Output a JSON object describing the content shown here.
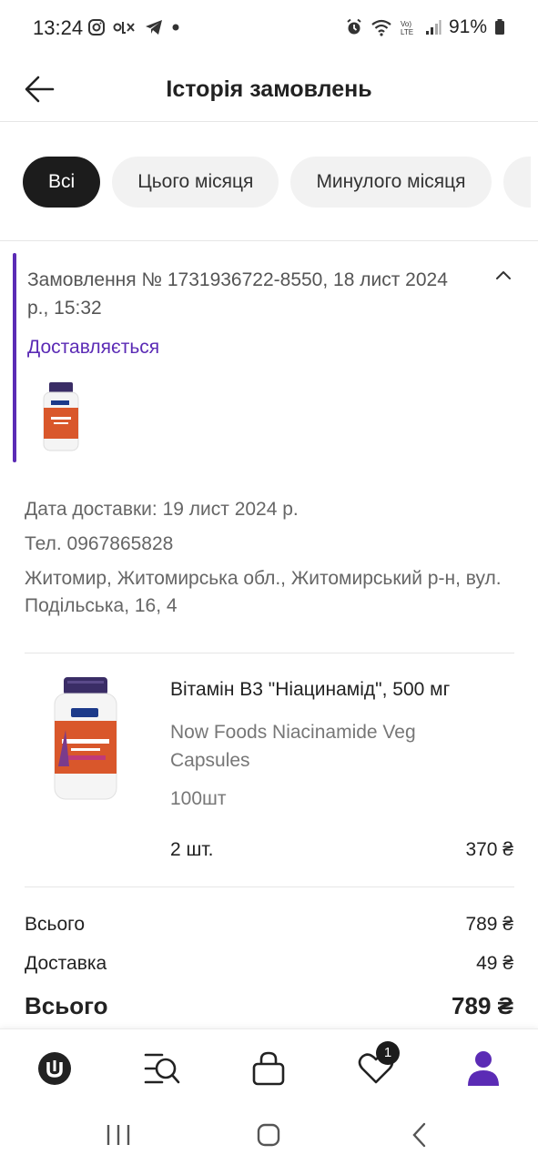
{
  "status_bar": {
    "time": "13:24",
    "battery": "91%",
    "left_icons": [
      "instagram-icon",
      "olx-icon",
      "telegram-icon",
      "dot-icon"
    ],
    "right_icons": [
      "alarm-icon",
      "wifi-icon",
      "volte-icon",
      "signal-icon",
      "battery-icon"
    ]
  },
  "header": {
    "title": "Історія замовлень"
  },
  "filters": [
    {
      "label": "Всі",
      "active": true
    },
    {
      "label": "Цього місяця",
      "active": false
    },
    {
      "label": "Минулого місяця",
      "active": false
    }
  ],
  "order": {
    "title": "Замовлення № 1731936722-8550, 18 лист 2024 р., 15:32",
    "status": "Доставляється",
    "delivery_date": "Дата доставки: 19 лист 2024 р.",
    "phone": "Тел. 0967865828",
    "address": "Житомир, Житомирська обл., Житомирський р-н, вул. Подільська, 16, 4"
  },
  "product": {
    "name": "Вітамін B3 \"Ніацинамід\", 500 мг",
    "subtitle": "Now Foods Niacinamide Veg Capsules",
    "pack": "100шт",
    "qty": "2 шт.",
    "price": "370 ₴"
  },
  "summary": {
    "subtotal_label": "Всього",
    "subtotal_value": "789 ₴",
    "delivery_label": "Доставка",
    "delivery_value": "49 ₴",
    "total_label": "Всього",
    "total_value": "789 ₴"
  },
  "tabbar": {
    "favorites_badge": "1",
    "tabs": [
      "home-logo-icon",
      "catalog-search-icon",
      "cart-bag-icon",
      "favorites-heart-icon",
      "profile-icon"
    ]
  },
  "colors": {
    "accent": "#5b2bb5",
    "chip_active": "#1c1c1c",
    "chip_inactive": "#f2f2f2"
  }
}
